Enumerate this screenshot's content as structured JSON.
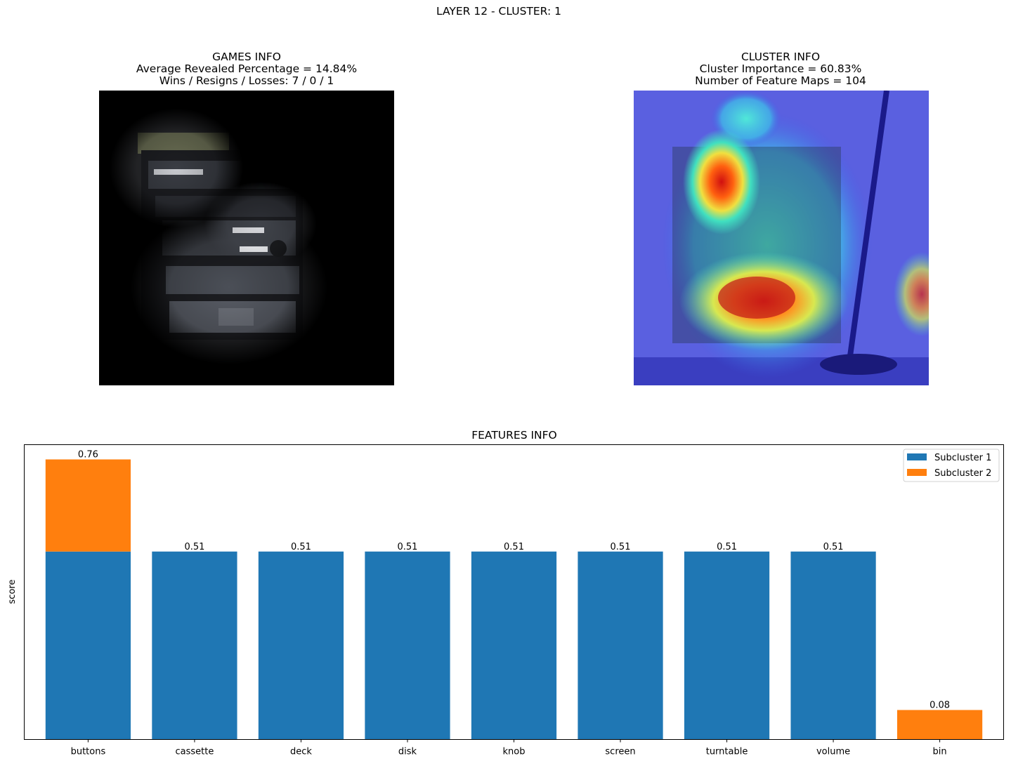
{
  "suptitle": "LAYER 12 - CLUSTER: 1",
  "games_info": {
    "title": "GAMES INFO",
    "line1": "Average Revealed Percentage = 14.84%",
    "line2": "Wins / Resigns / Losses: 7 / 0 / 1"
  },
  "cluster_info": {
    "title": "CLUSTER INFO",
    "line1": "Cluster Importance = 60.83%",
    "line2": "Number of Feature Maps = 104"
  },
  "colors": {
    "subcluster_1": "#1f77b4",
    "subcluster_2": "#ff7f0e"
  },
  "chart_data": {
    "type": "bar",
    "stacked": true,
    "title": "FEATURES INFO",
    "xlabel": "",
    "ylabel": "score",
    "ylim": [
      0,
      0.8
    ],
    "y_ticks_shown": false,
    "categories": [
      "buttons",
      "cassette",
      "deck",
      "disk",
      "knob",
      "screen",
      "turntable",
      "volume",
      "bin"
    ],
    "series": [
      {
        "name": "Subcluster 1",
        "values": [
          0.51,
          0.51,
          0.51,
          0.51,
          0.51,
          0.51,
          0.51,
          0.51,
          0
        ]
      },
      {
        "name": "Subcluster 2",
        "values": [
          0.25,
          0,
          0,
          0,
          0,
          0,
          0,
          0,
          0.08
        ]
      }
    ],
    "totals": [
      0.76,
      0.51,
      0.51,
      0.51,
      0.51,
      0.51,
      0.51,
      0.51,
      0.08
    ],
    "total_labels": [
      "0.76",
      "0.51",
      "0.51",
      "0.51",
      "0.51",
      "0.51",
      "0.51",
      "0.51",
      "0.08"
    ],
    "legend": {
      "position": "top-right",
      "entries": [
        "Subcluster 1",
        "Subcluster 2"
      ]
    },
    "grid": false
  }
}
